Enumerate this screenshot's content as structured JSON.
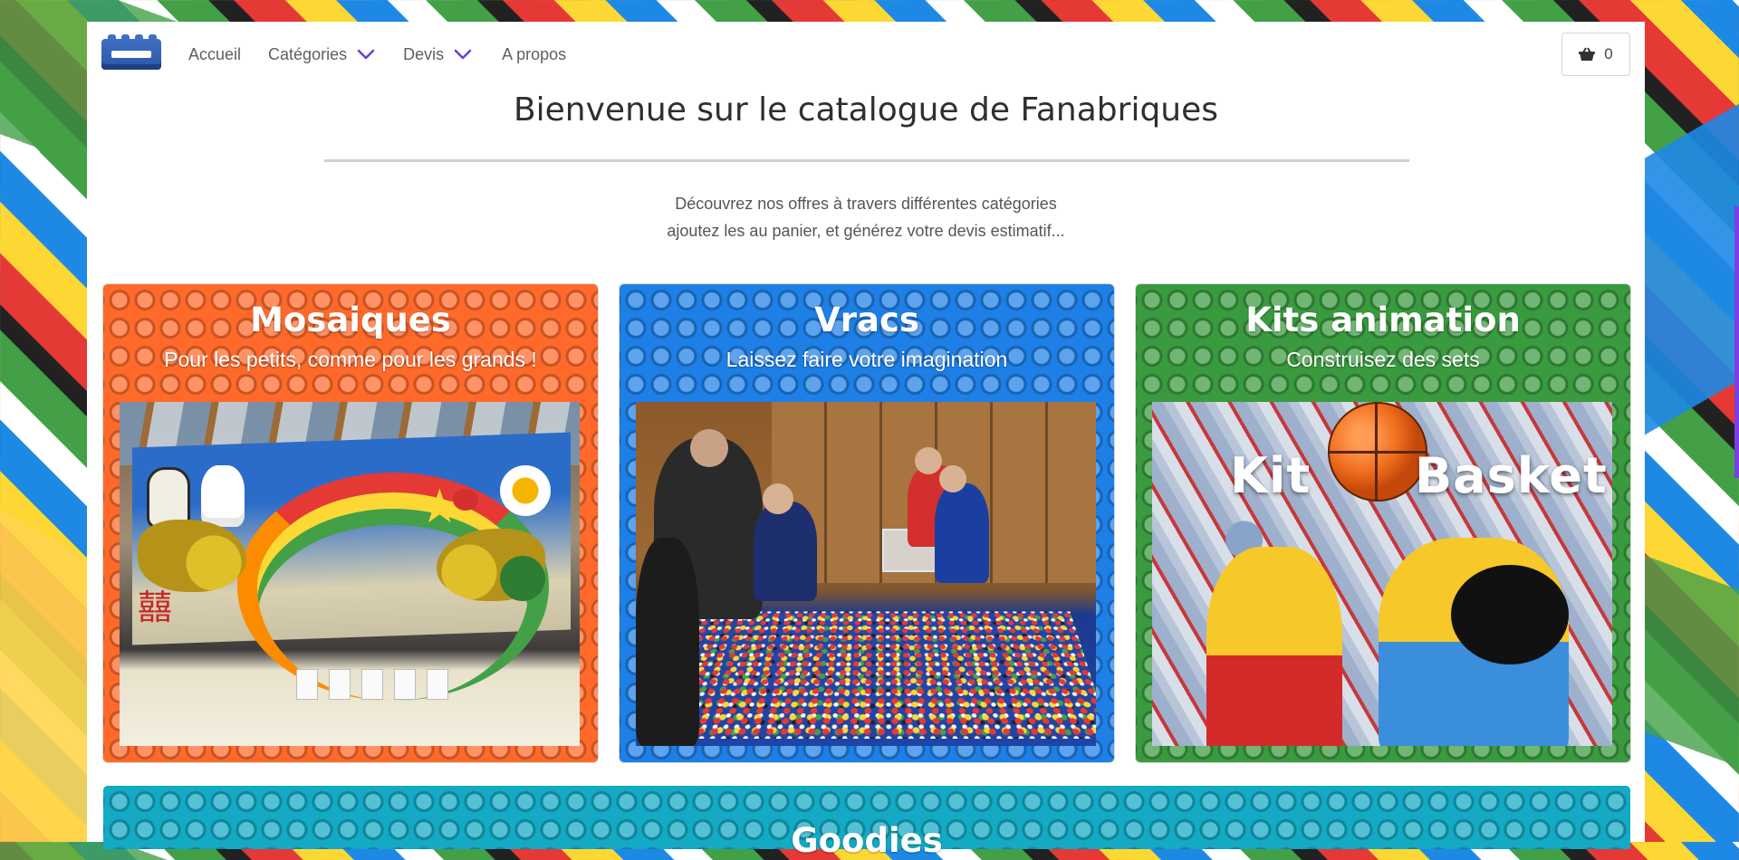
{
  "nav": {
    "home": "Accueil",
    "categories": "Catégories",
    "devis": "Devis",
    "about": "A propos",
    "cart_count": "0"
  },
  "page": {
    "title": "Bienvenue sur le catalogue de Fanabriques",
    "intro_line1": "Découvrez nos offres à travers différentes catégories",
    "intro_line2": "ajoutez les au panier, et générez votre devis estimatif..."
  },
  "categories": [
    {
      "title": "Mosaiques",
      "subtitle": "Pour les petits, comme pour les grands !",
      "color": "#ff6a2b",
      "hanzi": "囍"
    },
    {
      "title": "Vracs",
      "subtitle": "Laissez faire votre imagination",
      "color": "#1e7fe6"
    },
    {
      "title": "Kits animation",
      "subtitle": "Construisez des sets",
      "color": "#3a9a3f",
      "photo_text_left": "Kit",
      "photo_text_right": "Basket"
    },
    {
      "title": "Goodies",
      "color": "#14a9c4"
    }
  ],
  "colors": {
    "nav_chevron": "#6a3fd6",
    "scroll_accent": "#7b3fe4"
  },
  "icons": {
    "cart": "shopping-basket-icon",
    "chevron": "chevron-down-icon",
    "logo": "brick-logo-icon"
  }
}
